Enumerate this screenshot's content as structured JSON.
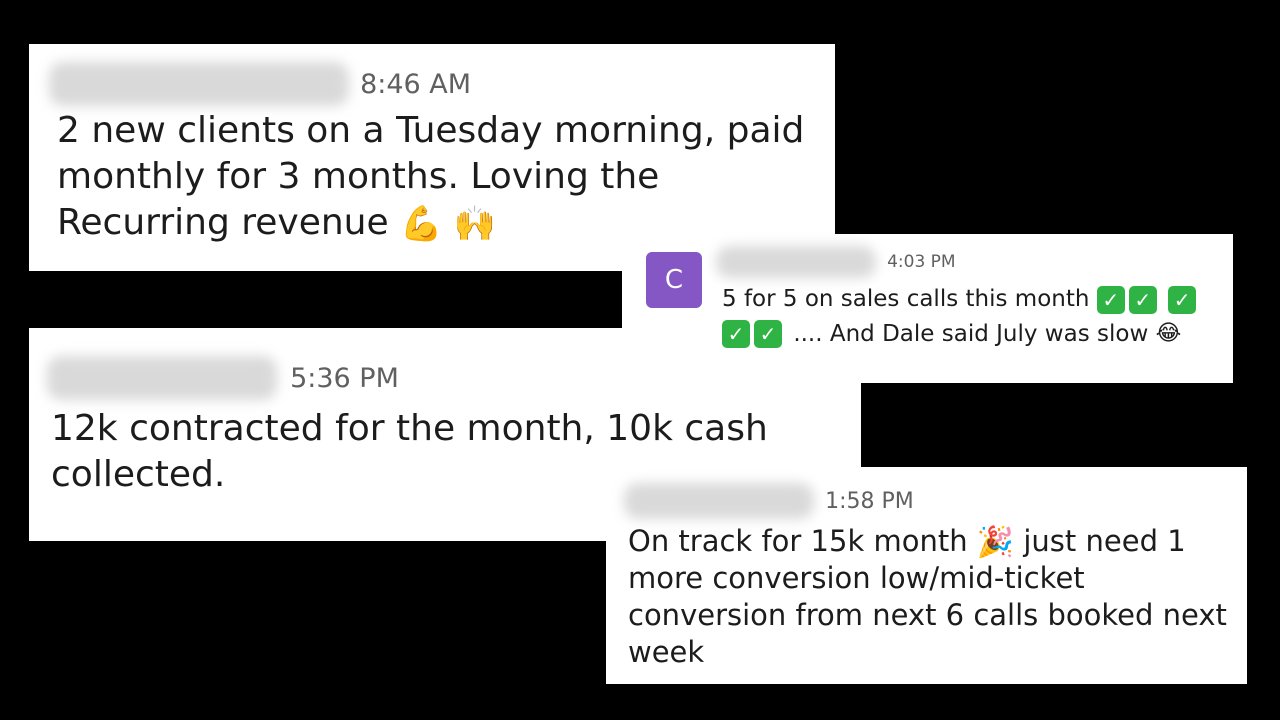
{
  "messages": [
    {
      "time": "8:46 AM",
      "text": "2 new clients on a Tuesday morning, paid monthly for 3 months. Loving the Recurring revenue",
      "emojis": [
        "flexed-biceps",
        "raising-hands"
      ]
    },
    {
      "time": "5:36 PM",
      "text": "12k contracted for the month, 10k cash collected."
    },
    {
      "avatar_letter": "C",
      "avatar_color": "#8557c5",
      "time": "4:03 PM",
      "text_a": "5 for 5 on sales calls this month",
      "text_b": ".... And Dale said July was slow",
      "check_count": 5,
      "check_color": "#2fb344",
      "emojis": [
        "white-check-mark",
        "face-with-tears-of-joy"
      ]
    },
    {
      "time": "1:58 PM",
      "text_a": "On track for 15k month",
      "text_b": "just need 1 more conversion low/mid-ticket conversion from next 6 calls booked next week",
      "emojis": [
        "party-popper"
      ]
    }
  ]
}
